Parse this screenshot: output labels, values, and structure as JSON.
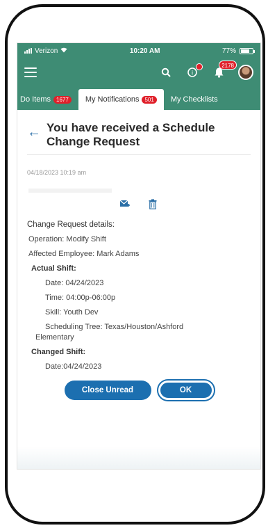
{
  "status_bar": {
    "carrier": "Verizon",
    "time": "10:20 AM",
    "battery": "77%"
  },
  "header": {
    "notification_count": "2178"
  },
  "tabs": [
    {
      "label": "Do Items",
      "count": "1677"
    },
    {
      "label": "My Notifications",
      "count": "501"
    },
    {
      "label": "My Checklists",
      "count": ""
    }
  ],
  "notification": {
    "title_line1": "You have received a Schedule",
    "title_line2": "Change Request",
    "datetime": "04/18/2023 10:19 am"
  },
  "details": {
    "heading": "Change Request details:",
    "operation": "Operation: Modify Shift",
    "affected_employee": "Affected Employee: Mark Adams",
    "actual_shift": "Actual Shift:",
    "actual_date": "Date: 04/24/2023",
    "actual_time": "Time: 04:00p-06:00p",
    "actual_skill": "Skill: Youth Dev",
    "actual_tree_line1": "Scheduling Tree: Texas/Houston/Ashford",
    "actual_tree_line2": "Elementary",
    "changed_shift": "Changed Shift:",
    "changed_date": "Date:04/24/2023"
  },
  "buttons": {
    "close_unread": "Close Unread",
    "ok": "OK"
  },
  "colors": {
    "header_green": "#3e8c74",
    "primary_blue": "#1c6fb0",
    "badge_red": "#e0202a"
  },
  "icons": [
    "menu-icon",
    "search-icon",
    "notification-help-icon",
    "bell-icon",
    "avatar",
    "back-arrow-icon",
    "mark-email-icon",
    "trash-icon"
  ]
}
